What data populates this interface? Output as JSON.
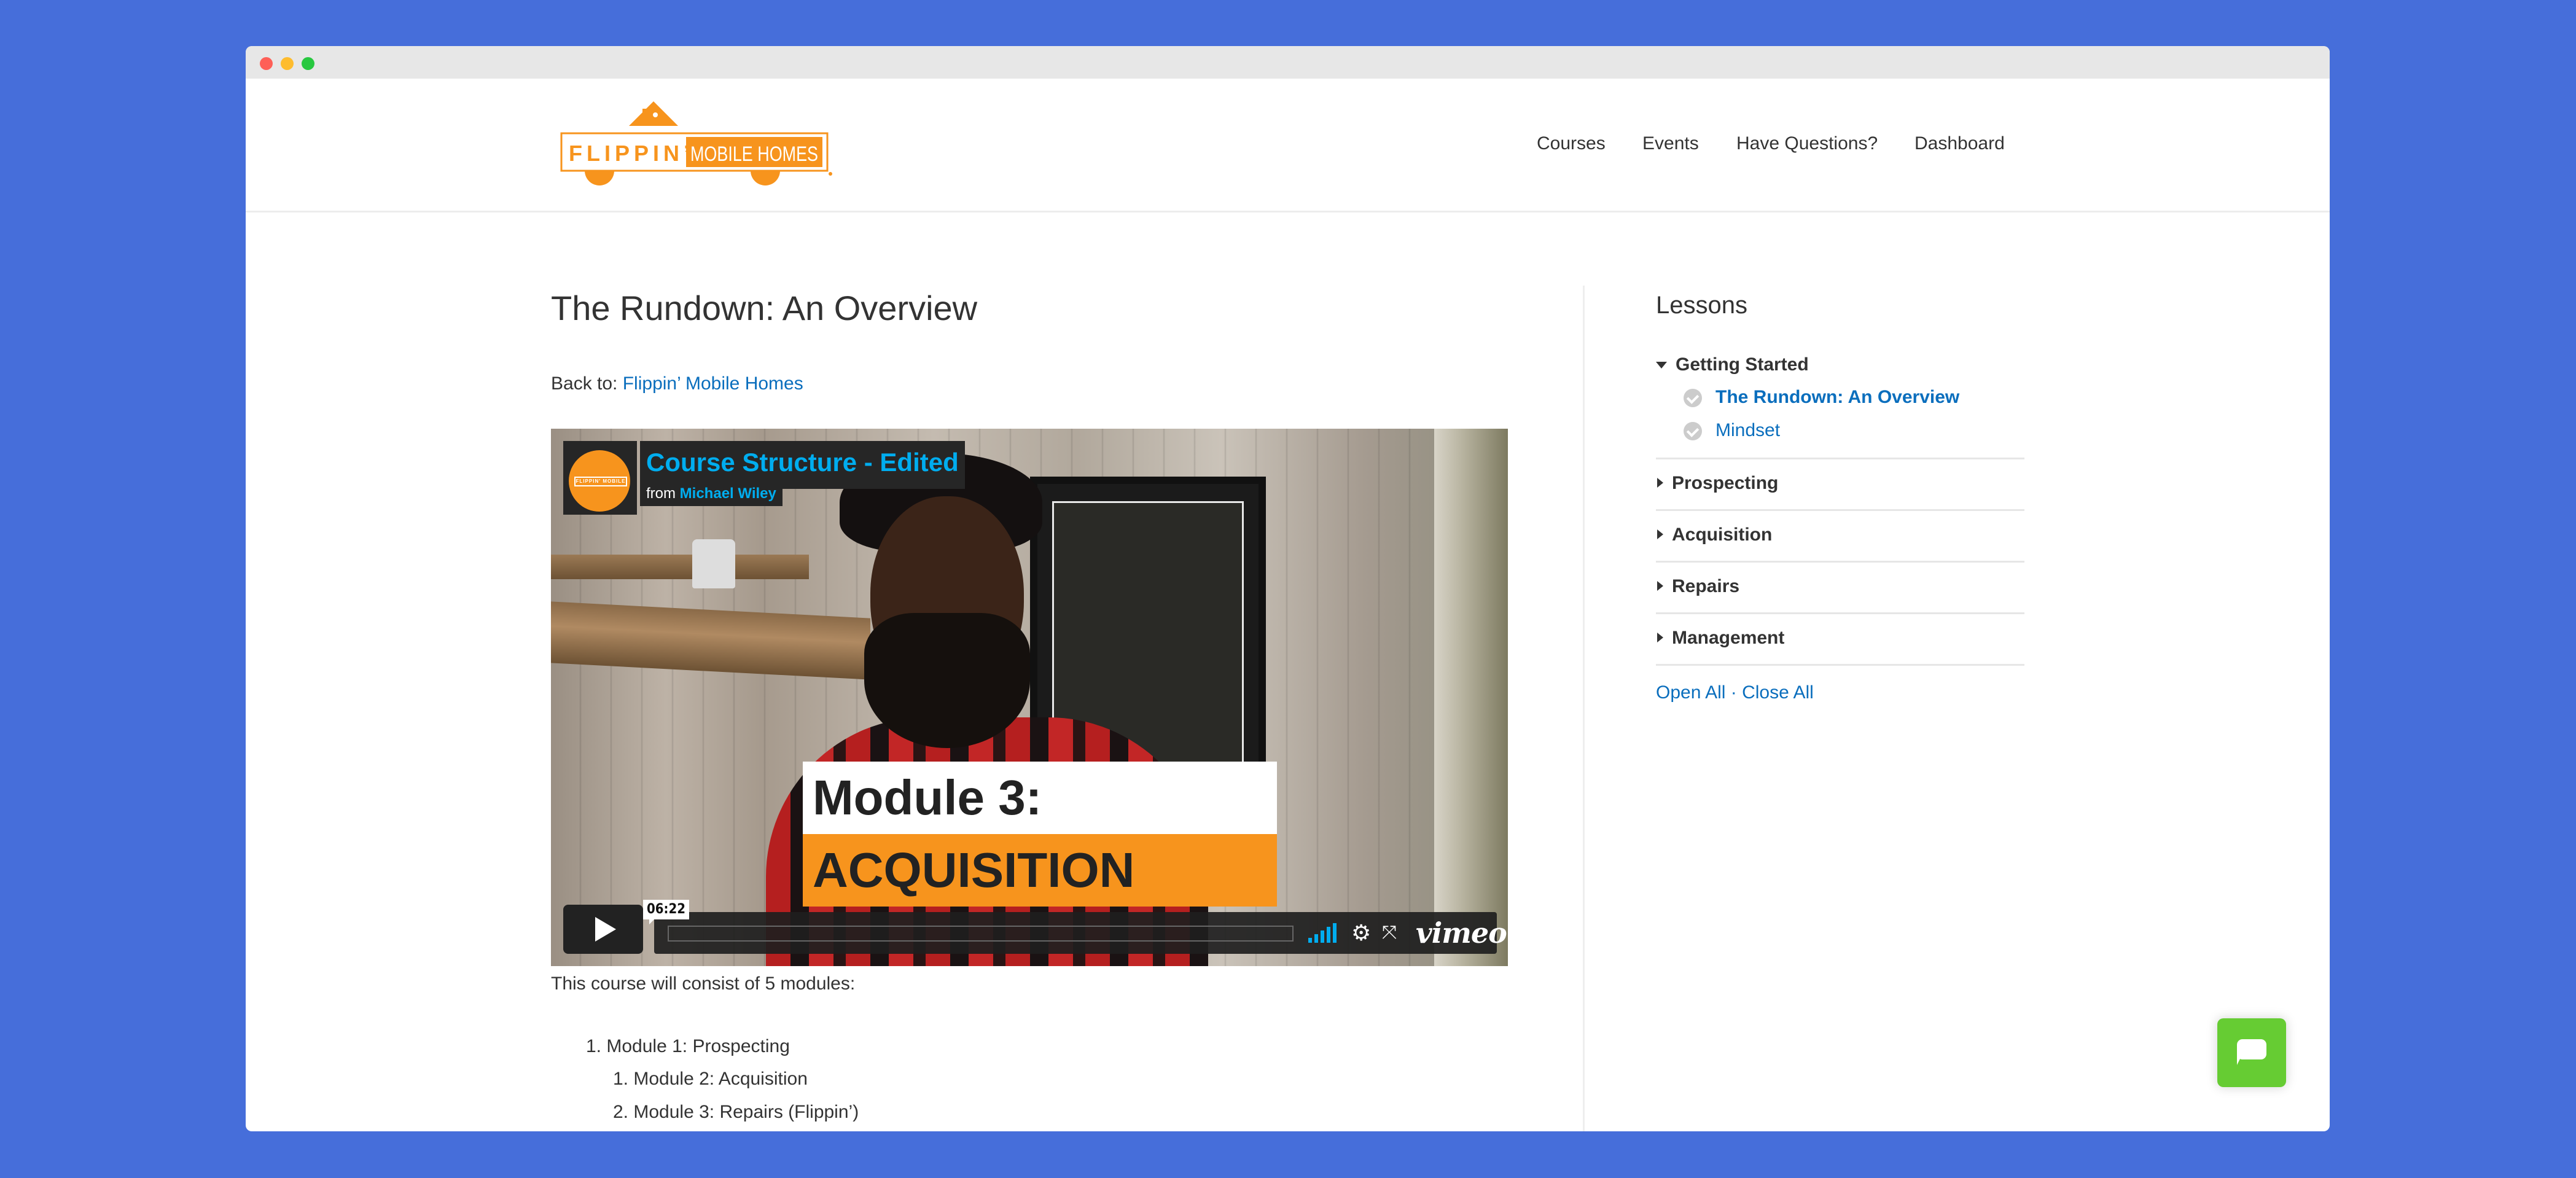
{
  "window": {
    "controls": [
      "close",
      "minimize",
      "maximize"
    ]
  },
  "header": {
    "logo": {
      "part1": "FLIPPIN’",
      "part2": "MOBILE HOMES",
      "alt": "Flippin' Mobile Homes logo"
    },
    "nav": [
      {
        "label": "Courses"
      },
      {
        "label": "Events"
      },
      {
        "label": "Have Questions?"
      },
      {
        "label": "Dashboard"
      }
    ]
  },
  "main": {
    "title": "The Rundown: An Overview",
    "back_to_label": "Back to:",
    "back_to_link": "Flippin’ Mobile Homes",
    "video": {
      "title": "Course Structure - Edited",
      "byline_prefix": "from",
      "author": "Michael Wiley",
      "badge_text": "FLIPPIN' MOBILE HOMES",
      "lower_third_line1": "Module 3:",
      "lower_third_line2": "ACQUISITION",
      "duration": "06:22",
      "progress": 0,
      "volume_icon": "volume-bars-icon",
      "settings_icon": "gear-icon",
      "fullscreen_icon": "fullscreen-icon",
      "brand": "vimeo"
    },
    "intro": "This course will consist of 5 modules:",
    "modules": [
      {
        "number": "1.",
        "text": "Module 1: Prospecting",
        "level": 1
      },
      {
        "number": "1.",
        "text": "Module 2: Acquisition",
        "level": 2
      },
      {
        "number": "2.",
        "text": "Module 3: Repairs (Flippin’)",
        "level": 2
      }
    ]
  },
  "sidebar": {
    "title": "Lessons",
    "sections": [
      {
        "label": "Getting Started",
        "expanded": true,
        "lessons": [
          {
            "label": "The Rundown: An Overview",
            "current": true,
            "completed": false
          },
          {
            "label": "Mindset",
            "current": false,
            "completed": false
          }
        ]
      },
      {
        "label": "Prospecting",
        "expanded": false
      },
      {
        "label": "Acquisition",
        "expanded": false
      },
      {
        "label": "Repairs",
        "expanded": false
      },
      {
        "label": "Management",
        "expanded": false
      }
    ],
    "open_all": "Open All",
    "separator": " · ",
    "close_all": "Close All"
  },
  "chat": {
    "icon": "chat-bubble-icon",
    "color": "#66CC33"
  },
  "colors": {
    "background": "#466EDA",
    "link": "#0A6EBD",
    "brand_orange": "#F7941D",
    "vimeo_blue": "#00ADEF"
  }
}
